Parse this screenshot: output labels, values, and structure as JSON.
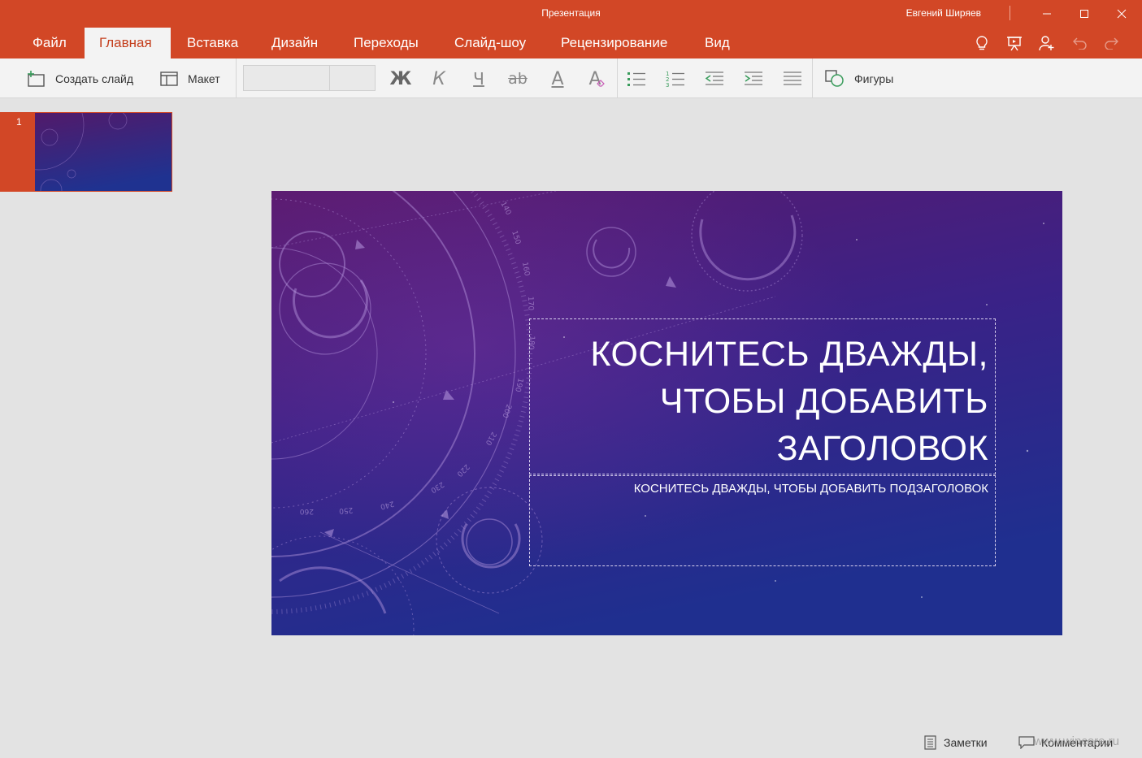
{
  "window": {
    "title": "Презентация",
    "user": "Евгений Ширяев",
    "controls": [
      "minimize",
      "maximize",
      "close"
    ]
  },
  "tabs": [
    {
      "label": "Файл",
      "active": false
    },
    {
      "label": "Главная",
      "active": true
    },
    {
      "label": "Вставка",
      "active": false
    },
    {
      "label": "Дизайн",
      "active": false
    },
    {
      "label": "Переходы",
      "active": false
    },
    {
      "label": "Слайд-шоу",
      "active": false
    },
    {
      "label": "Рецензирование",
      "active": false
    },
    {
      "label": "Вид",
      "active": false
    }
  ],
  "tab_icons": [
    "lightbulb-icon",
    "present-icon",
    "share-person-icon",
    "undo-icon",
    "redo-icon"
  ],
  "ribbon": {
    "new_slide": "Создать слайд",
    "layout": "Макет",
    "font_name": "",
    "font_size": "",
    "bold": "Ж",
    "italic": "К",
    "underline": "Ч",
    "strike": "ab",
    "font_color": "A",
    "clear_format": "A",
    "shapes": "Фигуры"
  },
  "thumbnails": [
    {
      "number": "1",
      "selected": true
    }
  ],
  "slide": {
    "title_lines": [
      "КОСНИТЕСЬ ДВАЖДЫ,",
      "ЧТОБЫ ДОБАВИТЬ",
      "ЗАГОЛОВОК"
    ],
    "subtitle": "КОСНИТЕСЬ ДВАЖДЫ, ЧТОБЫ ДОБАВИТЬ ПОДЗАГОЛОВОК",
    "dial_labels": [
      "140",
      "150",
      "160",
      "170",
      "180",
      "190",
      "200",
      "210",
      "220",
      "230",
      "240",
      "250",
      "260"
    ]
  },
  "status": {
    "notes": "Заметки",
    "comments": "Комментарии"
  },
  "watermark": "www.wincore.ru",
  "colors": {
    "accent": "#d24726",
    "ribbon_bg": "#f3f3f3",
    "workspace_bg": "#e3e3e3",
    "slide_top": "#5a1a6e",
    "slide_bottom": "#1f2f8f"
  }
}
